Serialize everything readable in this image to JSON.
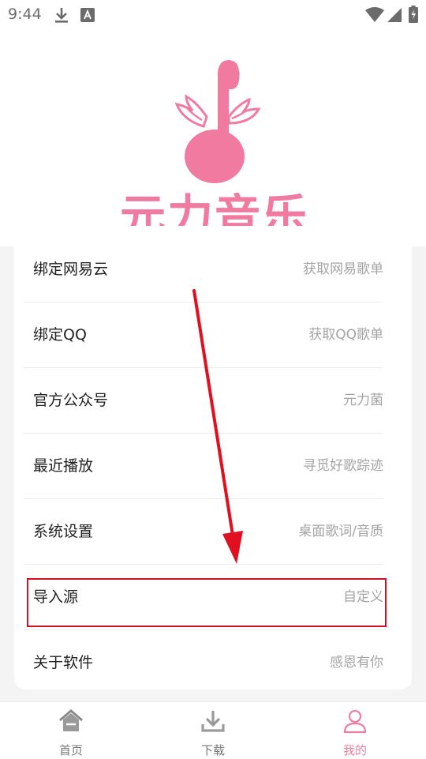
{
  "status_bar": {
    "time": "9:44"
  },
  "app": {
    "logo_text": "元力音乐",
    "brand_color": "#f07aa0"
  },
  "menu": [
    {
      "title": "绑定网易云",
      "subtitle": "获取网易歌单"
    },
    {
      "title": "绑定QQ",
      "subtitle": "获取QQ歌单"
    },
    {
      "title": "官方公众号",
      "subtitle": "元力菌"
    },
    {
      "title": "最近播放",
      "subtitle": "寻觅好歌踪迹"
    },
    {
      "title": "系统设置",
      "subtitle": "桌面歌词/音质"
    },
    {
      "title": "导入源",
      "subtitle": "自定义"
    },
    {
      "title": "关于软件",
      "subtitle": "感恩有你"
    }
  ],
  "tabs": [
    {
      "label": "首页",
      "icon": "home-icon"
    },
    {
      "label": "下载",
      "icon": "download-icon"
    },
    {
      "label": "我的",
      "icon": "user-icon",
      "active": true
    }
  ],
  "annotation_color": "#e01020"
}
